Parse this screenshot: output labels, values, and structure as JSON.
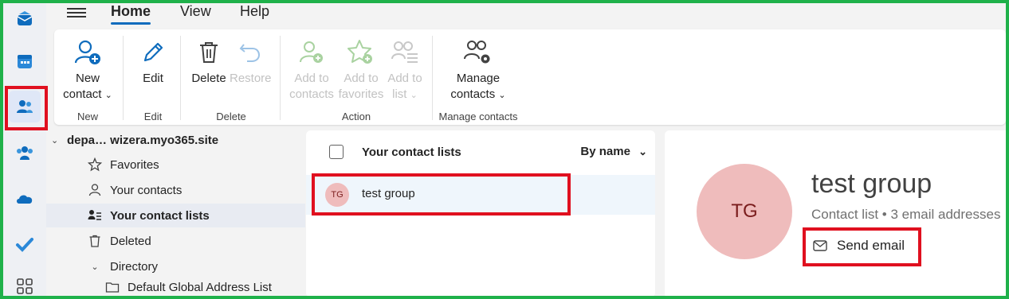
{
  "menu": {
    "tabs": [
      "Home",
      "View",
      "Help"
    ],
    "active": "Home"
  },
  "ribbon": {
    "new_contact": [
      "New",
      "contact"
    ],
    "new_group": "New",
    "edit": "Edit",
    "edit_group": "Edit",
    "delete": "Delete",
    "restore": "Restore",
    "delete_group": "Delete",
    "add_to_contacts": [
      "Add to",
      "contacts"
    ],
    "add_to_favorites": [
      "Add to",
      "favorites"
    ],
    "add_to_list": [
      "Add to",
      "list"
    ],
    "action_group": "Action",
    "manage_contacts": [
      "Manage",
      "contacts"
    ],
    "manage_group": "Manage contacts"
  },
  "nav": {
    "account": "depa… wizera.myo365.site",
    "items": [
      "Favorites",
      "Your contacts",
      "Your contact lists",
      "Deleted",
      "Directory",
      "Default Global Address List"
    ],
    "selected": "Your contact lists"
  },
  "list": {
    "title": "Your contact lists",
    "sort": "By name",
    "rows": [
      {
        "initials": "TG",
        "name": "test group"
      }
    ]
  },
  "detail": {
    "initials": "TG",
    "name": "test group",
    "subtitle": "Contact list • 3 email addresses",
    "send_email": "Send email"
  },
  "colors": {
    "accent": "#0f6cbd",
    "highlight": "#e0101f",
    "frame": "#1fb14a",
    "avatar_bg": "#efbcbc"
  }
}
